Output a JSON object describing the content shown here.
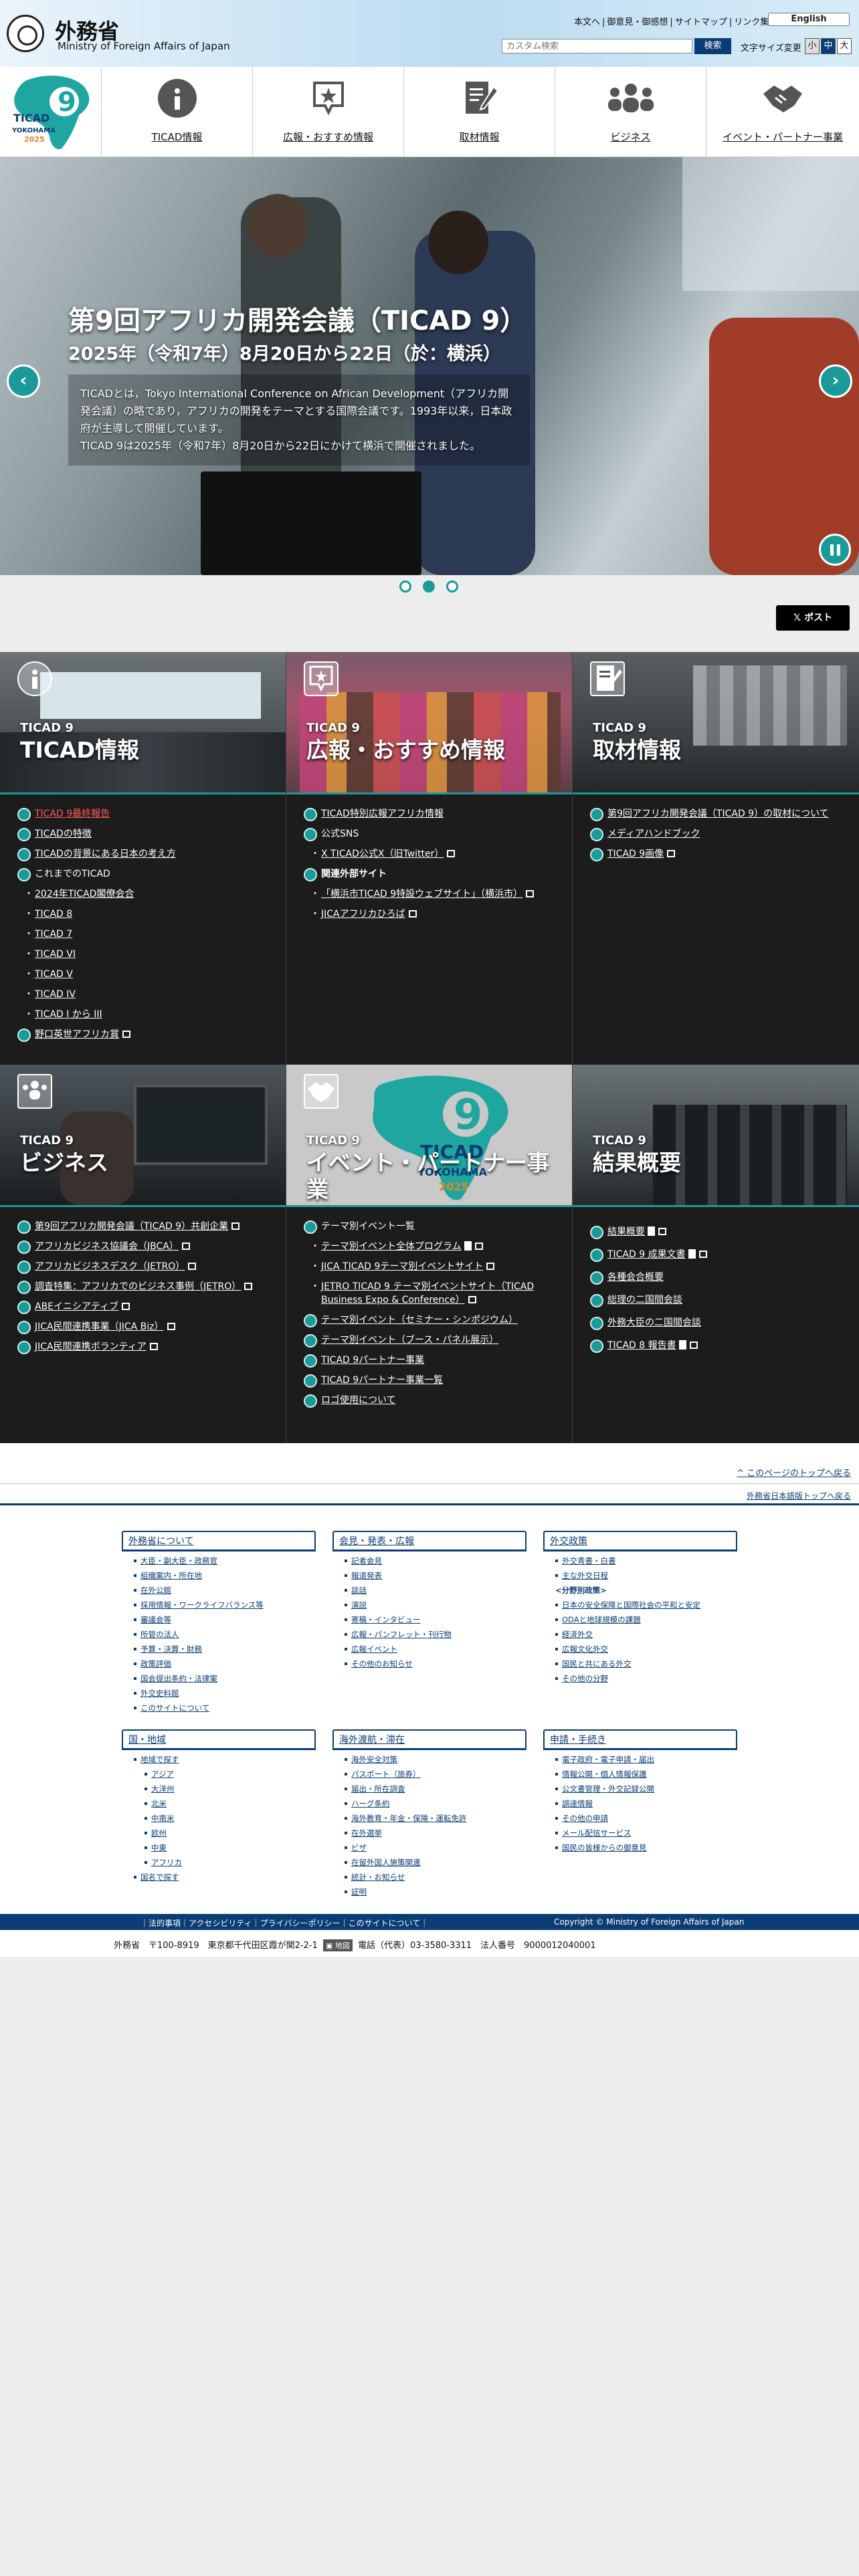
{
  "header": {
    "logo_jp": "外務省",
    "logo_en": "Ministry of Foreign Affairs of Japan",
    "util_links": [
      "本文へ",
      "御意見・御感想",
      "サイトマップ",
      "リンク集"
    ],
    "english": "English",
    "search_placeholder": "カスタム検索",
    "search_button": "検索",
    "font_size_label": "文字サイズ変更",
    "font_sizes": [
      "小",
      "中",
      "大"
    ]
  },
  "nav": {
    "logo_text": "TICAD 9 YOKOHAMA 2025",
    "items": [
      {
        "label": "TICAD情報",
        "icon": "info-icon"
      },
      {
        "label": "広報・おすすめ情報",
        "icon": "star-bubble-icon"
      },
      {
        "label": "取材情報",
        "icon": "document-pen-icon"
      },
      {
        "label": "ビジネス",
        "icon": "people-group-icon"
      },
      {
        "label": "イベント・パートナー事業",
        "icon": "handshake-icon"
      }
    ]
  },
  "hero": {
    "title": "第9回アフリカ開発会議（TICAD 9）",
    "subtitle": "2025年（令和7年）8月20日から22日（於：横浜）",
    "desc1": "TICADとは，Tokyo International Conference on African Development（アフリカ開",
    "desc2": "発会議）の略であり，アフリカの開発をテーマとする国際会議です。1993年以来，日本政",
    "desc3": "府が主導して開催しています。",
    "desc4": "TICAD 9は2025年（令和7年）8月20日から22日にかけて横浜で開催されました。",
    "prev": "‹",
    "next": "›"
  },
  "post_button": "ポスト",
  "tiles": {
    "info": {
      "small": "TICAD 9",
      "big": "TICAD情報",
      "items": [
        "TICAD 9最終報告",
        "TICADの特徴",
        "TICADの背景にある日本の考え方",
        "これまでのTICAD",
        "2024年TICAD閣僚会合",
        "TICAD 8",
        "TICAD 7",
        "TICAD VI",
        "TICAD V",
        "TICAD IV",
        "TICAD I から III",
        "野口英世アフリカ賞"
      ]
    },
    "pr": {
      "small": "TICAD 9",
      "big": "広報・おすすめ情報",
      "items": [
        "TICAD特別広報アフリカ情報",
        "公式SNS",
        "X TICAD公式X（旧Twitter）",
        "関連外部サイト",
        "「横浜市TICAD 9特設ウェブサイト」（横浜市）",
        "JICAアフリカひろば"
      ]
    },
    "press": {
      "small": "TICAD 9",
      "big": "取材情報",
      "items": [
        "第9回アフリカ開発会議（TICAD 9）の取材について",
        "メディアハンドブック",
        "TICAD 9画像"
      ]
    },
    "business": {
      "small": "TICAD 9",
      "big": "ビジネス",
      "items": [
        "第9回アフリカ開発会議（TICAD 9）共創企業",
        "アフリカビジネス協議会（JBCA）",
        "アフリカビジネスデスク（JETRO）",
        "調査特集：アフリカでのビジネス事例（JETRO）",
        "ABEイニシアティブ",
        "JICA民間連携事業（JICA Biz）",
        "JICA民間連携ボランティア"
      ]
    },
    "event": {
      "small": "TICAD 9",
      "big1": "イベント・パートナー事",
      "big2": "業",
      "items": [
        "テーマ別イベント一覧",
        "テーマ別イベント全体プログラム",
        "JICA TICAD 9テーマ別イベントサイト",
        "JETRO TICAD 9 テーマ別イベントサイト（TICAD",
        "Business Expo & Conference）",
        "テーマ別イベント（セミナー・シンポジウム）",
        "テーマ別イベント（ブース・パネル展示）",
        "TICAD 9パートナー事業",
        "TICAD 9パートナー事業一覧",
        "ロゴ使用について"
      ]
    },
    "results": {
      "small": "TICAD 9",
      "big": "結果概要",
      "items": [
        "結果概要",
        "TICAD 9 成果文書",
        "各種会合概要",
        "総理の二国間会談",
        "外務大臣の二国間会談",
        "TICAD 8 報告書"
      ]
    }
  },
  "pagetop": {
    "to_top": "^ このページのトップへ戻る",
    "home": "外務省日本語版トップへ戻る"
  },
  "footer": {
    "col1": {
      "head": "外務省について",
      "items": [
        "大臣・副大臣・政務官",
        "組織案内・所在地",
        "在外公館",
        "採用情報・ワークライフバランス等",
        "審議会等",
        "所管の法人",
        "予算・決算・財務",
        "政策評価",
        "国会提出条約・法律案",
        "外交史料館",
        "このサイトについて"
      ]
    },
    "col2": {
      "head": "会見・発表・広報",
      "items": [
        "記者会見",
        "報道発表",
        "談話",
        "演説",
        "寄稿・インタビュー",
        "広報・パンフレット・刊行物",
        "広報イベント",
        "その他のお知らせ"
      ]
    },
    "col3": {
      "head": "外交政策",
      "items": [
        "外交青書・白書",
        "主な外交日程"
      ],
      "subhead": "<分野別政策>",
      "items2": [
        "日本の安全保障と国際社会の平和と安定",
        "ODAと地球規模の課題",
        "経済外交",
        "広報文化外交",
        "国民と共にある外交",
        "その他の分野"
      ]
    },
    "col4": {
      "head": "国・地域",
      "items": [
        "地域で探す"
      ],
      "sub": [
        "アジア",
        "大洋州",
        "北米",
        "中南米",
        "欧州",
        "中東",
        "アフリカ"
      ],
      "items2": [
        "国名で探す"
      ]
    },
    "col5": {
      "head": "海外渡航・滞在",
      "items": [
        "海外安全対策",
        "パスポート（旅券）",
        "届出・所在調査",
        "ハーグ条約",
        "海外教育・年金・保険・運転免許",
        "在外選挙",
        "ビザ",
        "在留外国人施策関連",
        "統計・お知らせ",
        "証明"
      ]
    },
    "col6": {
      "head": "申請・手続き",
      "items": [
        "電子政府・電子申請・届出",
        "情報公開・個人情報保護",
        "公文書管理・外交記録公開",
        "調達情報",
        "その他の申請",
        "メール配信サービス",
        "国民の皆様からの御意見"
      ]
    },
    "bar_links": "｜法的事項｜アクセシビリティ｜プライバシーポリシー｜このサイトについて｜",
    "copyright": "Copyright © Ministry of Foreign Affairs of Japan",
    "address": "外務省　〒100-8919　東京都千代田区霞が関2-2-1",
    "map_badge": "地図",
    "phone": "電話（代表）03-3580-3311　法人番号　9000012040001"
  }
}
